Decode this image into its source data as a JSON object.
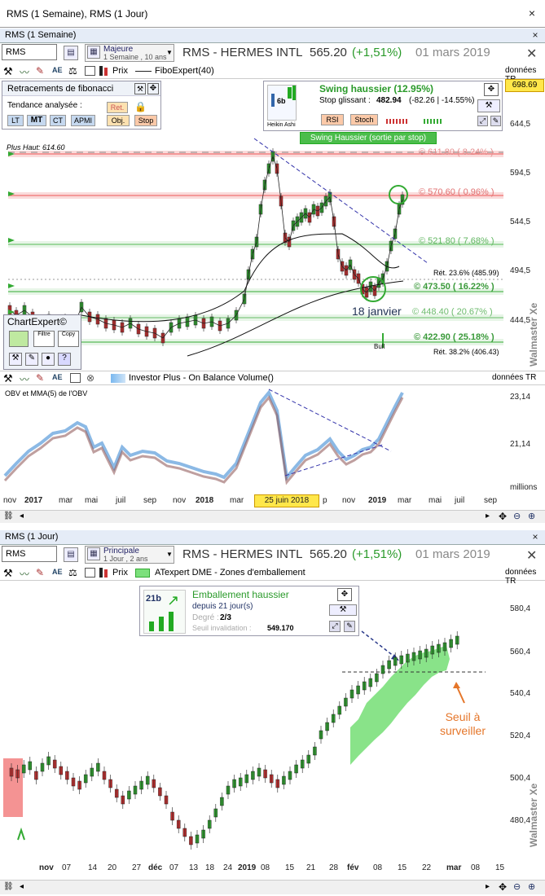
{
  "window": {
    "title": "RMS (1 Semaine), RMS (1 Jour)",
    "close": "×"
  },
  "top_panel": {
    "caption": "RMS (1 Semaine)",
    "symbol": "RMS",
    "period_name": "Majeure",
    "period_detail": "1 Semaine , 10 ans",
    "instrument": "RMS - HERMES INTL",
    "price": "565.20",
    "change": "(+1,51%)",
    "date": "01 mars 2019",
    "source": "données TR",
    "prix_label": "Prix",
    "indicator": "FiboExpert(40)",
    "fibo_box": {
      "title": "Retracements de fibonacci",
      "trend_label": "Tendance analysée :",
      "buttons": [
        "LT",
        "MT",
        "CT",
        "APMI"
      ],
      "ret": "Ret.",
      "obj": "Obj.",
      "stop": "Stop"
    },
    "swing_box": {
      "icon_label": "6b",
      "heikin": "Heikin Ashi",
      "title": "Swing haussier (12.95%)",
      "stop_label": "Stop glissant :",
      "stop_value": "482.94",
      "stop_change": "(-82.26 | -14.55%)",
      "rsi": "RSI",
      "stoch": "Stoch",
      "banner": "Swing Haussier (sortie par stop)"
    },
    "plus_haut": "Plus Haut: 614.60",
    "levels": [
      "© 611.80 ( 8.24% )",
      "© 570.60 ( 0.96% )",
      "© 521.80 ( 7.68% )",
      "© 473.50 ( 16.22% )",
      "© 448.40 ( 20.67% )",
      "© 422.90 ( 25.18% )"
    ],
    "ret1": "Rét. 23.6% (485.99)",
    "ret2": "Rét. 38.2% (406.43)",
    "annotation": "18 janvier",
    "price_axis": [
      "698.69",
      "644,5",
      "594,5",
      "544,5",
      "494,5",
      "444,5"
    ],
    "chartexpert": "ChartExpert©",
    "ce_labels": [
      "Filtre",
      "Copy"
    ],
    "bull": "Bull",
    "watermark": "Walmaster Xe"
  },
  "obv_panel": {
    "indicator": "Investor Plus - On Balance Volume()",
    "source": "données TR",
    "label": "OBV et MMA(5) de l'OBV",
    "axis": [
      "23,14",
      "21,14"
    ],
    "units": "millions"
  },
  "weekly_dates": [
    "nov",
    "2017",
    "mar",
    "mai",
    "juil",
    "sep",
    "nov",
    "2018",
    "mar",
    "p",
    "nov",
    "2019",
    "mar",
    "mai",
    "juil",
    "sep"
  ],
  "weekly_highlight": "25 juin 2018",
  "bottom_panel": {
    "caption": "RMS (1 Jour)",
    "symbol": "RMS",
    "period_name": "Principale",
    "period_detail": "1 Jour , 2 ans",
    "instrument": "RMS - HERMES INTL",
    "price": "565.20",
    "change": "(+1,51%)",
    "date": "01 mars 2019",
    "source": "données TR",
    "prix_label": "Prix",
    "indicator": "ATexpert DME - Zones d'emballement",
    "dme_box": {
      "icon": "21b",
      "title": "Emballement haussier",
      "since": "depuis 21 jour(s)",
      "degree_label": "Degré :",
      "degree": "2/3",
      "seuil_label": "Seuil invalidation :",
      "seuil": "549.170"
    },
    "price_axis": [
      "580,4",
      "560,4",
      "540,4",
      "520,4",
      "500,4",
      "480,4"
    ],
    "annotation": "Seuil à surveiller",
    "watermark": "Walmaster Xe"
  },
  "daily_dates": [
    "nov",
    "07",
    "14",
    "20",
    "27",
    "déc",
    "07",
    "13",
    "18",
    "24",
    "2019",
    "08",
    "15",
    "21",
    "28",
    "fév",
    "08",
    "15",
    "22",
    "mar",
    "08",
    "15"
  ]
}
